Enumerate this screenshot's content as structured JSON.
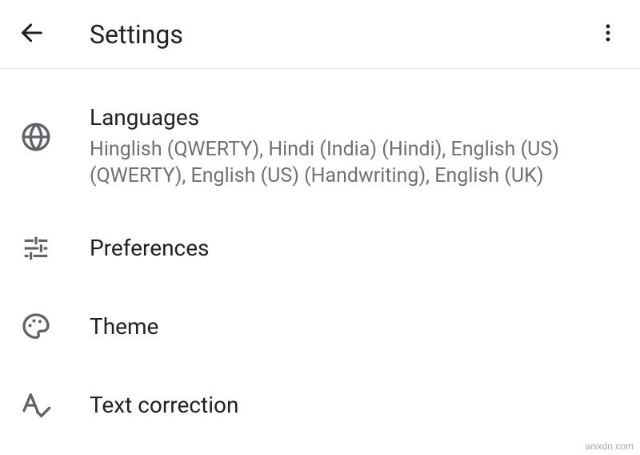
{
  "header": {
    "title": "Settings"
  },
  "items": {
    "languages": {
      "title": "Languages",
      "subtitle": "Hinglish (QWERTY), Hindi (India) (Hindi), English (US) (QWERTY), English (US) (Handwriting), English (UK)"
    },
    "preferences": {
      "title": "Preferences"
    },
    "theme": {
      "title": "Theme"
    },
    "text_correction": {
      "title": "Text correction"
    }
  },
  "watermark": "wsxdn.com"
}
